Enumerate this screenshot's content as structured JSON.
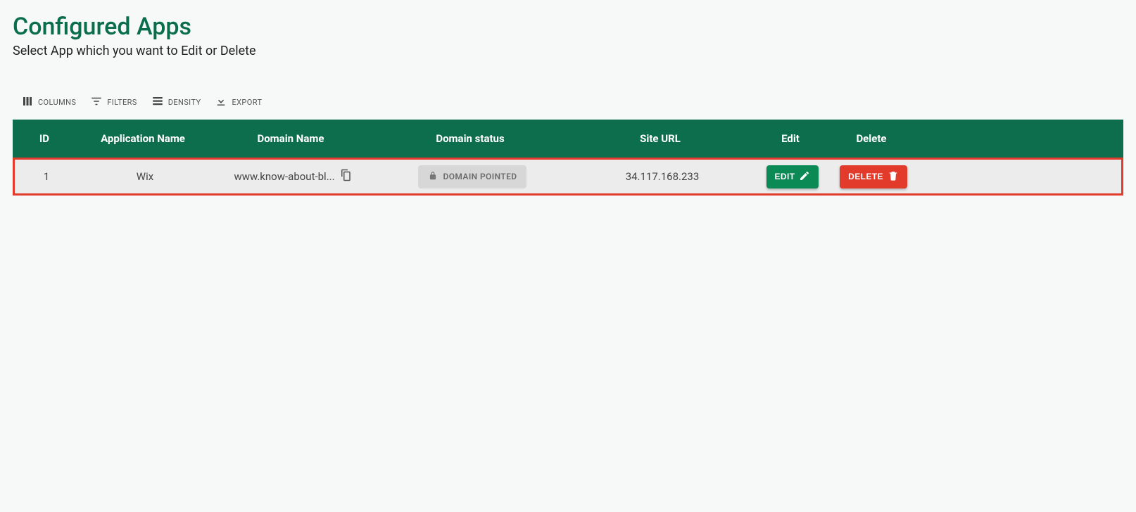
{
  "header": {
    "title": "Configured Apps",
    "subtitle": "Select App which you want to Edit or Delete"
  },
  "toolbar": {
    "columns": "COLUMNS",
    "filters": "FILTERS",
    "density": "DENSITY",
    "export": "EXPORT"
  },
  "table": {
    "columns": {
      "id": "ID",
      "app_name": "Application Name",
      "domain_name": "Domain Name",
      "domain_status": "Domain status",
      "site_url": "Site URL",
      "edit": "Edit",
      "delete": "Delete"
    },
    "rows": [
      {
        "id": "1",
        "app_name": "Wix",
        "domain_name": "www.know-about-bl...",
        "domain_status": "DOMAIN POINTED",
        "site_url": "34.117.168.233",
        "edit_label": "EDIT",
        "delete_label": "DELETE"
      }
    ]
  }
}
